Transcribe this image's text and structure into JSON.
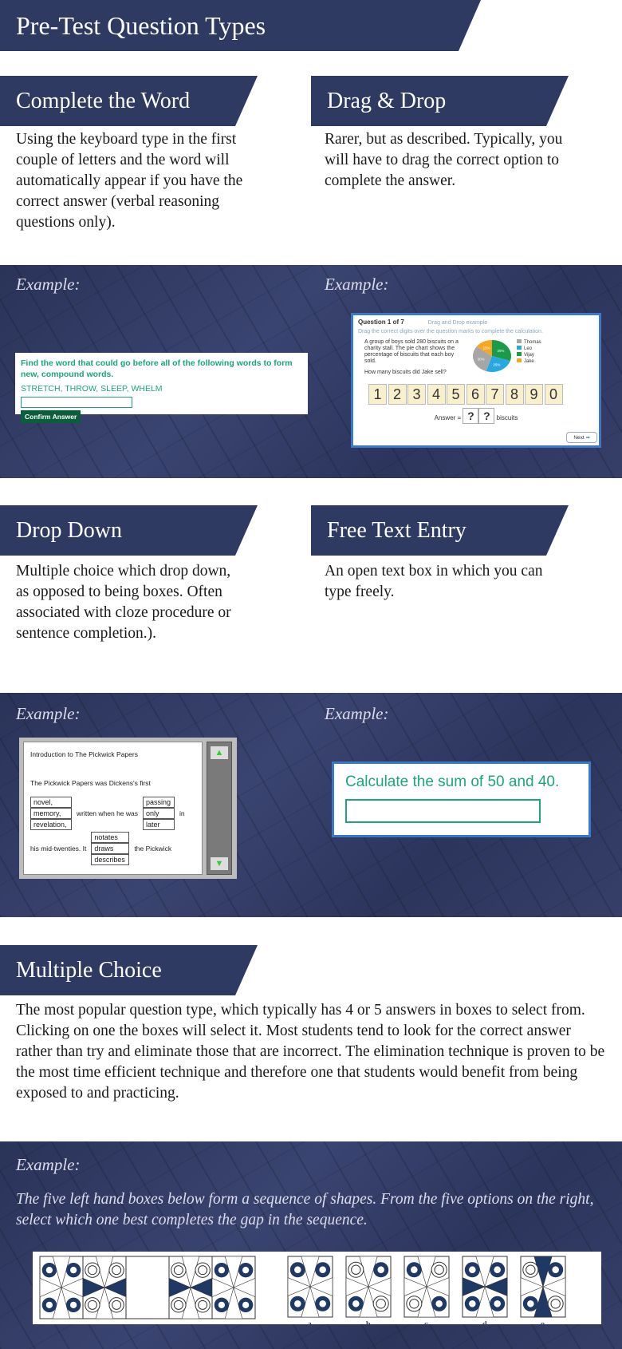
{
  "title": "Pre-Test Question Types",
  "example_label": "Example:",
  "complete_word": {
    "heading": "Complete the Word",
    "description": "Using the keyboard type in the first couple of letters and the word will automatically appear if you have the correct answer (verbal reasoning questions only).",
    "example": {
      "prompt": "Find the word that could go before all of the following words to form new, compound words.",
      "words": "STRETCH, THROW, SLEEP, WHELM",
      "input_value": "",
      "button": "Confirm Answer"
    }
  },
  "drag_drop": {
    "heading": "Drag & Drop",
    "description": "Rarer, but as described. Typically, you will have to drag the correct option to complete the answer.",
    "example": {
      "question": "Question 1 of 7",
      "subtitle": "Drag and Drop example",
      "instruction": "Drag the correct digits over the question marks to complete the calculation.",
      "text": "A group of boys sold 280 biscuits on a charity stall. The pie chart shows the percentage of biscuits that each boy sold.",
      "ask": "How many biscuits did Jake sell?",
      "pie": [
        {
          "name": "Thomas",
          "pct": "30%",
          "value": 30,
          "color": "#a6a6a6"
        },
        {
          "name": "Leo",
          "pct": "25%",
          "value": 25,
          "color": "#29a8e0"
        },
        {
          "name": "Vijay",
          "pct": "30%",
          "value": 30,
          "color": "#1a9b48"
        },
        {
          "name": "Jake",
          "pct": "15%",
          "value": 15,
          "color": "#f5a623"
        }
      ],
      "digits": [
        "1",
        "2",
        "3",
        "4",
        "5",
        "6",
        "7",
        "8",
        "9",
        "0"
      ],
      "answer_label": "Answer =",
      "slots": [
        "?",
        "?"
      ],
      "unit": "biscuits",
      "next": "Next"
    }
  },
  "drop_down": {
    "heading": "Drop Down",
    "description": "Multiple choice which drop down, as opposed to being boxes. Often associated with cloze procedure or sentence completion.).",
    "example": {
      "title": "Introduction to The Pickwick Papers",
      "line1": "The Pickwick Papers was Dickens's first",
      "opts1": [
        "novel,",
        "memory,",
        "revelation,"
      ],
      "mid": "written when he was",
      "opts2": [
        "passing",
        "only",
        "later"
      ],
      "in": "in",
      "line3a": "his mid-twenties. It",
      "opts3": [
        "notates",
        "draws",
        "describes"
      ],
      "line3b": "the Pickwick"
    }
  },
  "free_text": {
    "heading": "Free Text Entry",
    "description": "An open text box in which you can type freely.",
    "example": {
      "prompt": "Calculate the sum of 50 and 40.",
      "input_value": ""
    }
  },
  "multiple_choice": {
    "heading": "Multiple Choice",
    "description": "The most popular question type, which typically has 4 or 5 answers in boxes to select from. Clicking on one the boxes will select it. Most students tend to look for the correct answer rather than try and eliminate those that are incorrect. The elimination technique is proven to be the most time efficient technique and therefore one that students would benefit from being exposed to and practicing.",
    "example": {
      "instruction": "The five left hand boxes below form a sequence of shapes. From the five options on the right, select which one best completes the gap in the sequence.",
      "options": [
        "a",
        "b",
        "c",
        "d",
        "e"
      ]
    }
  },
  "colors": {
    "navy": "#2f3a63",
    "green": "#1aa67a",
    "dark_green": "#0b5e3b"
  }
}
